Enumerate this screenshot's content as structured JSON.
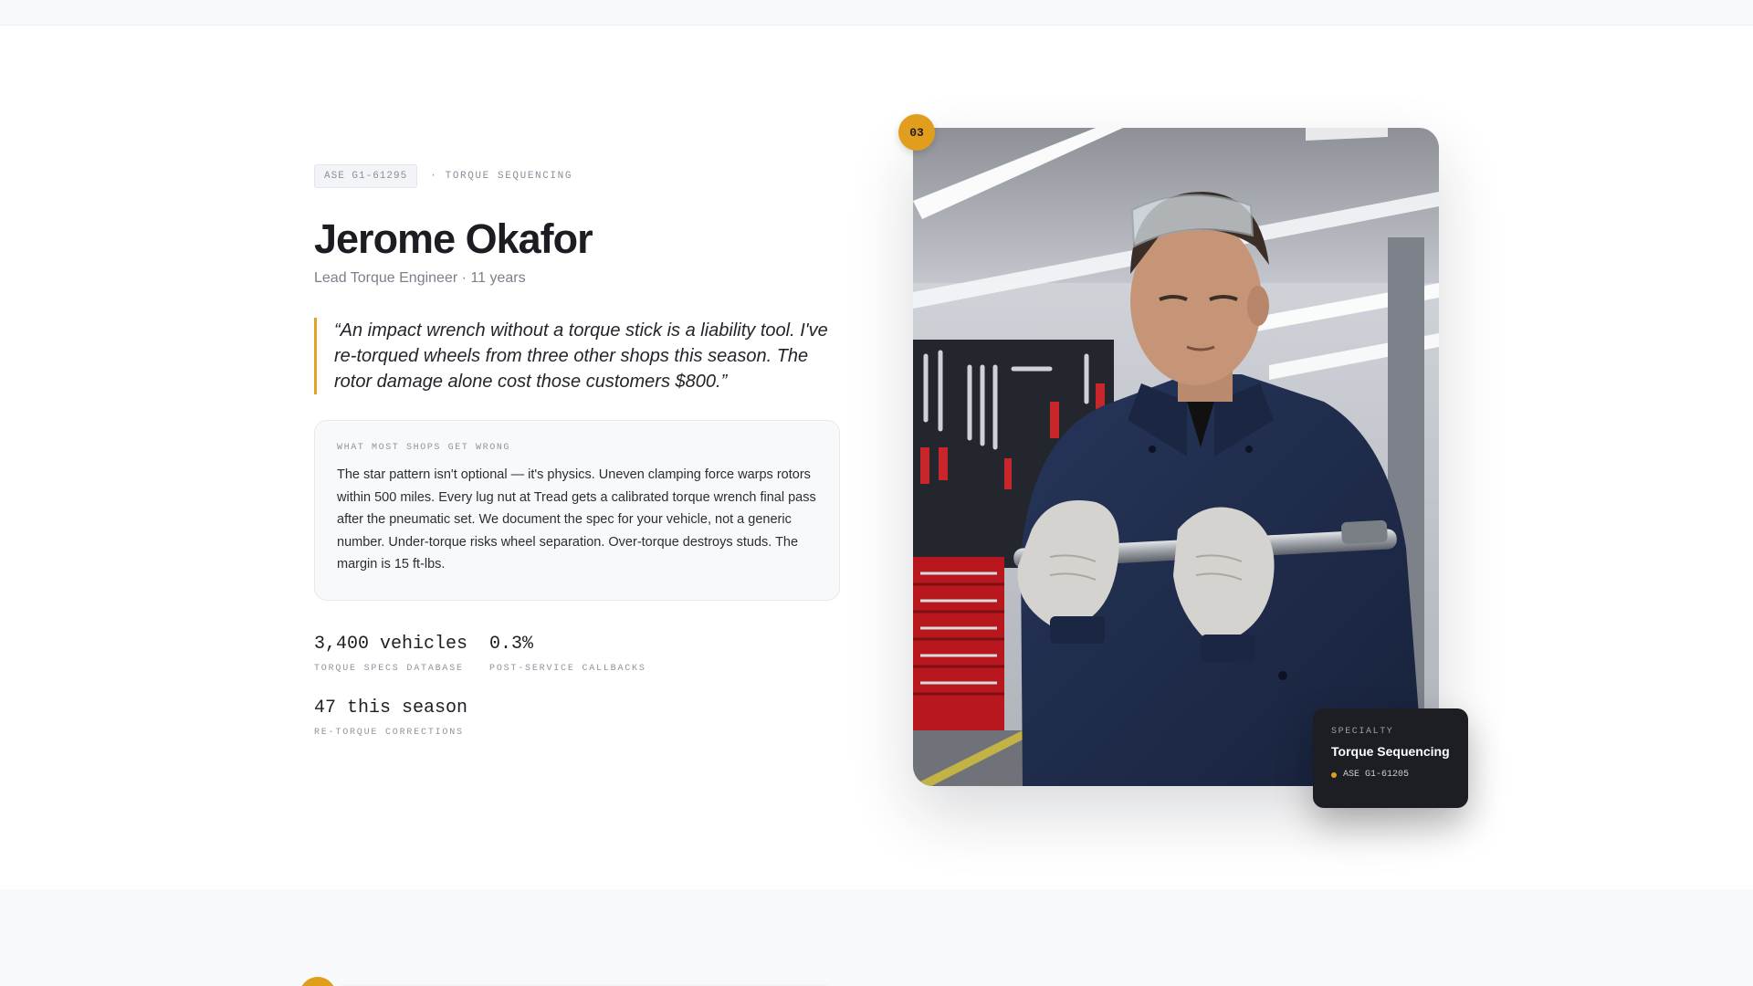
{
  "profile": {
    "cert_chip": "ASE G1-61295",
    "meta_tag": "· TORQUE SEQUENCING",
    "name": "Jerome Okafor",
    "role": "Lead Torque Engineer · 11 years",
    "quote": "“An impact wrench without a torque stick is a liability tool. I've re-torqued wheels from three other shops this season. The rotor damage alone cost those customers $800.”",
    "card": {
      "label": "WHAT MOST SHOPS GET WRONG",
      "body": "The star pattern isn't optional — it's physics. Uneven clamping force warps rotors within 500 miles. Every lug nut at Tread gets a calibrated torque wrench final pass after the pneumatic set. We document the spec for your vehicle, not a generic number. Under-torque risks wheel separation. Over-torque destroys studs. The margin is 15 ft-lbs."
    },
    "stats": [
      {
        "value": "3,400 vehicles",
        "label": "TORQUE SPECS DATABASE"
      },
      {
        "value": "0.3%",
        "label": "POST-SERVICE CALLBACKS"
      },
      {
        "value": "47 this season",
        "label": "RE-TORQUE CORRECTIONS"
      }
    ]
  },
  "photo": {
    "badge_number": "03",
    "specialty": {
      "label": "SPECIALTY",
      "title": "Torque Sequencing",
      "cert": "ASE G1-61205"
    }
  },
  "colors": {
    "accent": "#e19d1c",
    "dark_card": "#1c1e23",
    "uniform": "#1f2d4a"
  }
}
